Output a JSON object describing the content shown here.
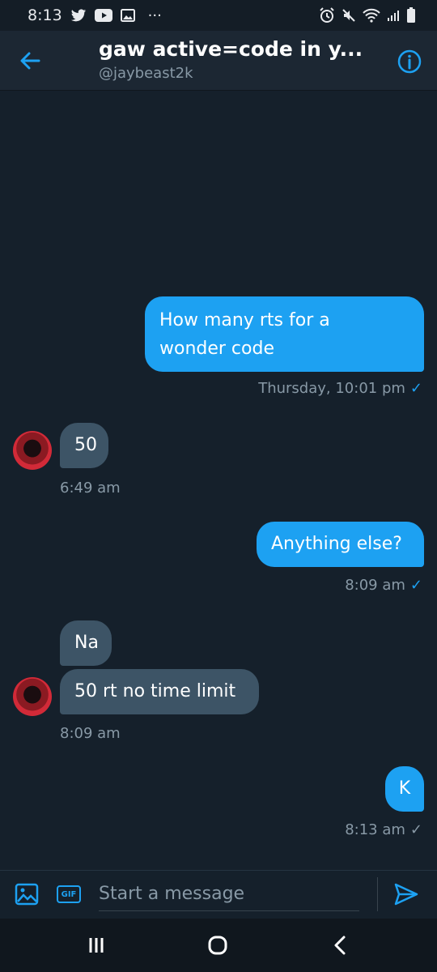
{
  "status_bar": {
    "time": "8:13",
    "dots": "···"
  },
  "header": {
    "title": "gaw active=code in y...",
    "handle": "@jaybeast2k"
  },
  "messages": [
    {
      "direction": "outgoing",
      "lines": [
        "How many rts for a",
        "wonder code"
      ],
      "meta": "Thursday, 10:01 pm"
    },
    {
      "direction": "incoming",
      "lines": [
        "50"
      ],
      "meta": "6:49 am"
    },
    {
      "direction": "outgoing",
      "lines": [
        "Anything else?"
      ],
      "meta": "8:09 am"
    },
    {
      "direction": "incoming",
      "lines": [
        "Na"
      ]
    },
    {
      "direction": "incoming",
      "lines": [
        "50 rt no time limit"
      ],
      "meta": "8:09 am"
    },
    {
      "direction": "outgoing",
      "lines": [
        "K"
      ],
      "meta": "8:13 am"
    }
  ],
  "composer": {
    "placeholder": "Start a message",
    "gif_label": "GIF"
  },
  "colors": {
    "background": "#15202b",
    "accent": "#1da1f2",
    "incoming_bubble": "#3d5466",
    "muted_text": "#8899a6"
  },
  "icons": [
    "back-arrow-icon",
    "info-icon",
    "image-icon",
    "gif-icon",
    "send-icon",
    "recents-icon",
    "home-icon",
    "back-nav-icon"
  ]
}
